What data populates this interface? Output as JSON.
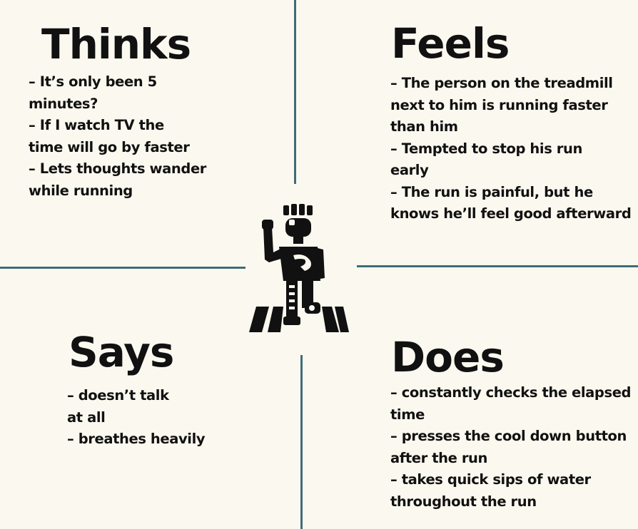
{
  "quadrants": {
    "thinks": {
      "title": "Thinks",
      "lines": [
        "– It’s only been 5",
        "minutes?",
        "– If I watch TV the",
        "time will go by faster",
        "– Lets thoughts wander",
        "while running"
      ]
    },
    "feels": {
      "title": "Feels",
      "lines": [
        "– The person on the treadmill",
        "next to him is running faster",
        "than him",
        "– Tempted to stop his run",
        "early",
        "– The run is painful, but he",
        "knows he’ll feel good afterward"
      ]
    },
    "says": {
      "title": "Says",
      "lines": [
        "– doesn’t talk",
        "at all",
        "– breathes heavily"
      ]
    },
    "does": {
      "title": "Does",
      "lines": [
        "– constantly checks the elapsed",
        "time",
        "– presses the cool down button",
        "after the run",
        "– takes quick sips of water",
        "throughout the run"
      ]
    }
  },
  "center_icon": "treadmill-runner-icon",
  "colors": {
    "background": "#fbf9ef",
    "divider": "#3f6c78",
    "text": "#111111"
  }
}
